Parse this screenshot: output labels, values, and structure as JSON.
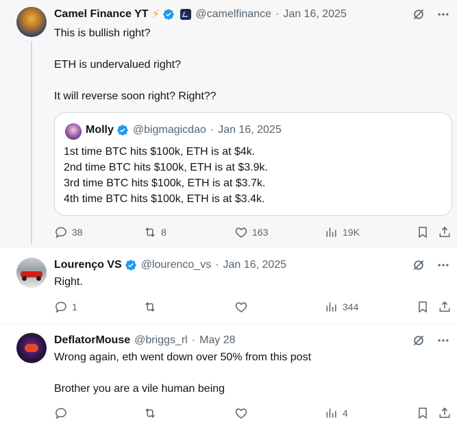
{
  "main_post": {
    "author_name": "Camel Finance YT",
    "badge_emoji": "⚡",
    "handle": "@camelfinance",
    "separator": "·",
    "date": "Jan 16, 2025",
    "text": "This is bullish right?\n\nETH is undervalued right?\n\nIt will reverse soon right? Right??",
    "quote": {
      "author_name": "Molly",
      "handle": "@bigmagicdao",
      "separator": "·",
      "date": "Jan 16, 2025",
      "text": "1st time BTC hits $100k, ETH is at $4k.\n2nd time BTC hits $100k, ETH is at $3.9k.\n3rd time BTC hits $100k, ETH is at $3.7k.\n4th time BTC hits $100k, ETH is at $3.4k."
    },
    "stats": {
      "replies": "38",
      "reposts": "8",
      "likes": "163",
      "views": "19K"
    }
  },
  "reply_1": {
    "author_name": "Lourenço VS",
    "handle": "@lourenco_vs",
    "separator": "·",
    "date": "Jan 16, 2025",
    "text": "Right.",
    "stats": {
      "replies": "1",
      "reposts": "",
      "likes": "",
      "views": "344"
    }
  },
  "reply_2": {
    "author_name": "DeflatorMouse",
    "handle": "@briggs_rl",
    "separator": "·",
    "date": "May 28",
    "text": "Wrong again, eth went down over 50% from this post\n\nBrother you are a vile human being",
    "stats": {
      "replies": "",
      "reposts": "",
      "likes": "",
      "views": "4"
    }
  },
  "icons": {
    "verified": "verified-badge-icon",
    "grok": "grok-icon",
    "more": "more-icon",
    "reply": "reply-icon",
    "repost": "repost-icon",
    "like": "like-icon",
    "views": "views-icon",
    "bookmark": "bookmark-icon",
    "share": "share-icon"
  },
  "colors": {
    "verified_blue": "#1d9bf0",
    "text": "#0f1419",
    "muted": "#536471",
    "bolt": "#f4b400"
  }
}
